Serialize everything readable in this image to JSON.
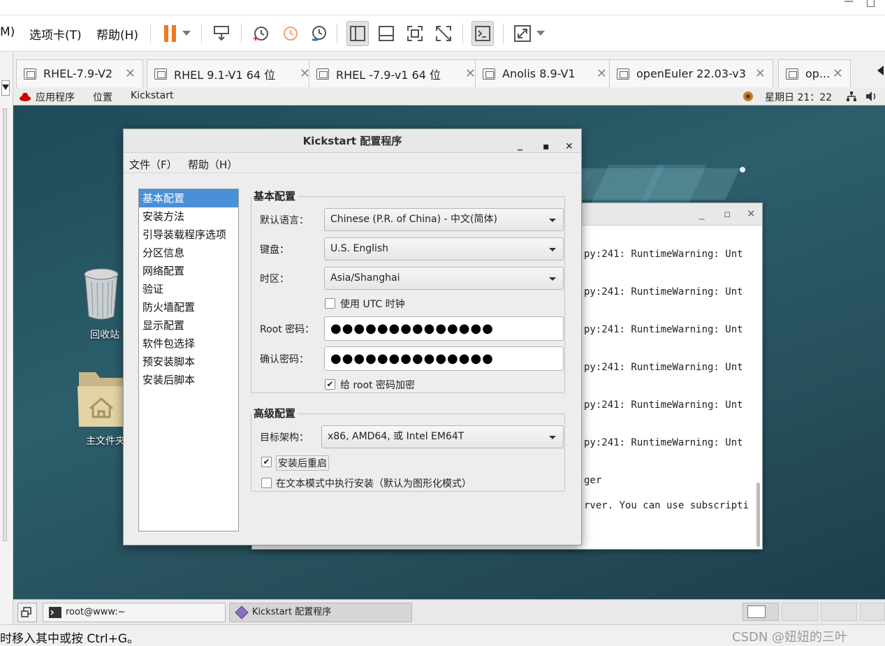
{
  "vm": {
    "menu": [
      "M)",
      "选项卡(T)",
      "帮助(H)"
    ],
    "tabs": [
      "RHEL-7.9-V2",
      "RHEL 9.1-V1 64 位",
      "RHEL -7.9-v1 64 位",
      "Anolis 8.9-V1",
      "openEuler 22.03-v3",
      "op..."
    ],
    "status_hint": "时移入其中或按 Ctrl+G。",
    "watermark": "CSDN @妞妞的三叶"
  },
  "guest": {
    "topbar": {
      "apps": "应用程序",
      "places": "位置",
      "kickstart": "Kickstart",
      "clock": "星期日 21：22"
    },
    "desktop_icons": {
      "trash": "回收站",
      "home": "主文件夹"
    },
    "terminal": {
      "lines": [
        "py:241: RuntimeWarning: Unt",
        "py:241: RuntimeWarning: Unt",
        "py:241: RuntimeWarning: Unt",
        "py:241: RuntimeWarning: Unt",
        "py:241: RuntimeWarning: Unt",
        "py:241: RuntimeWarning: Unt",
        "ger",
        "rver. You can use subscripti"
      ]
    },
    "taskbar": {
      "terminal_task": "root@www:~",
      "kickstart_task": "Kickstart 配置程序"
    }
  },
  "kickstart": {
    "title": "Kickstart 配置程序",
    "menu": {
      "file": "文件（F）",
      "help": "帮助（H）"
    },
    "nav": [
      "基本配置",
      "安装方法",
      "引导装载程序选项",
      "分区信息",
      "网络配置",
      "验证",
      "防火墙配置",
      "显示配置",
      "软件包选择",
      "预安装脚本",
      "安装后脚本"
    ],
    "basic": {
      "section_title": "基本配置",
      "lang_label": "默认语言：",
      "lang_value": "Chinese (P.R. of China) - 中文(简体)",
      "kbd_label": "键盘：",
      "kbd_value": "U.S. English",
      "tz_label": "时区：",
      "tz_value": "Asia/Shanghai",
      "utc_label": "使用  UTC 时钟",
      "root_label": "Root 密码：",
      "root_value": "●●●●●●●●●●●●●●",
      "confirm_label": "确认密码：",
      "confirm_value": "●●●●●●●●●●●●●●",
      "encrypt_label": "给  root 密码加密"
    },
    "advanced": {
      "section_title": "高级配置",
      "arch_label": "目标架构：",
      "arch_value": "x86, AMD64, 或  Intel EM64T",
      "reboot_label": "安装后重启",
      "text_mode_label": "在文本模式中执行安装（默认为图形化模式）"
    }
  }
}
